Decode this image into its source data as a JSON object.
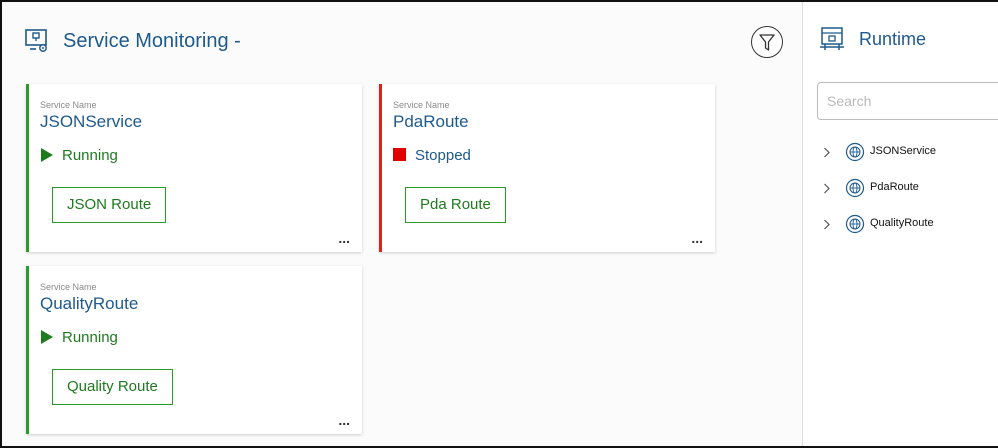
{
  "main": {
    "title": "Service Monitoring -",
    "title_icon": "monitor-gear-icon",
    "filter_icon": "filter-icon"
  },
  "cards": [
    {
      "label": "Service Name",
      "name": "JSONService",
      "status": "Running",
      "status_type": "running",
      "route_label": "JSON Route",
      "more": "...",
      "accent": "#2a9a2a"
    },
    {
      "label": "Service Name",
      "name": "PdaRoute",
      "status": "Stopped",
      "status_type": "stopped",
      "route_label": "Pda Route",
      "more": "...",
      "accent": "#e02020"
    },
    {
      "label": "Service Name",
      "name": "QualityRoute",
      "status": "Running",
      "status_type": "running",
      "route_label": "Quality Route",
      "more": "...",
      "accent": "#2a9a2a"
    }
  ],
  "side": {
    "title": "Runtime",
    "title_icon": "runtime-server-icon",
    "search_placeholder": "Search",
    "tree": [
      {
        "label": "JSONService"
      },
      {
        "label": "PdaRoute"
      },
      {
        "label": "QualityRoute"
      }
    ]
  },
  "colors": {
    "brand": "#1e5a8c",
    "running": "#1e7a1e",
    "stopped": "#e00000",
    "button_border": "#2a9a2a"
  }
}
